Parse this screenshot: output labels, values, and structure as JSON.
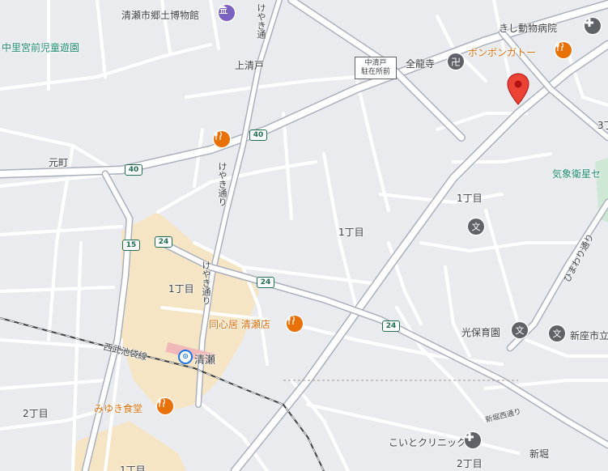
{
  "labels": {
    "museum": "清瀬市郷土博物館",
    "park": "中里宮前児童遊園",
    "area_kamikiyoto": "上清戸",
    "area_motomachi": "元町",
    "area_1chome_a": "1丁目",
    "area_1chome_b": "1丁目",
    "area_1chome_c": "1丁目",
    "area_2chome_a": "2丁目",
    "area_2chome_b": "2丁目",
    "area_1chome_d": "1丁目",
    "area_3_partial": "3丁",
    "area_shinbori": "新堀",
    "koban": "中清戸\n駐在所前",
    "zenryuji": "全龍寺",
    "vet": "きし動物病院",
    "bonbon": "ボンボンガトー",
    "kisho": "気象衛星セ",
    "koho": "光保育園",
    "niiza": "新座市立",
    "doshinkyo": "同心居 清瀬店",
    "miyuki": "みゆき食堂",
    "station": "清瀬",
    "railway": "西武池袋線",
    "koito": "こいとクリニック",
    "keyaki1": "けやき通",
    "keyaki2": "けやき通り",
    "keyaki3": "けやき通り",
    "himawari": "ひまわり通り",
    "shinbori_dori": "新堀西通り"
  },
  "road_shields": [
    "40",
    "40",
    "15",
    "24",
    "24",
    "24"
  ],
  "colors": {
    "background": "#e9ebef",
    "road": "#ffffff",
    "road_casing": "#aab0bb",
    "commercial_area": "#f6e5c4",
    "pin_red": "#ea4335",
    "poi_orange": "#e8710a",
    "school_grey": "#5f6368",
    "shield_green": "#1f6e4f",
    "railway": "#3c4043"
  },
  "icons": {
    "museum": "museum-icon",
    "restaurant": "fork-knife-icon",
    "school": "bun-school-icon",
    "clinic": "medical-icon",
    "pin": "red-pin-icon",
    "temple": "manji-icon",
    "station": "station-icon"
  }
}
